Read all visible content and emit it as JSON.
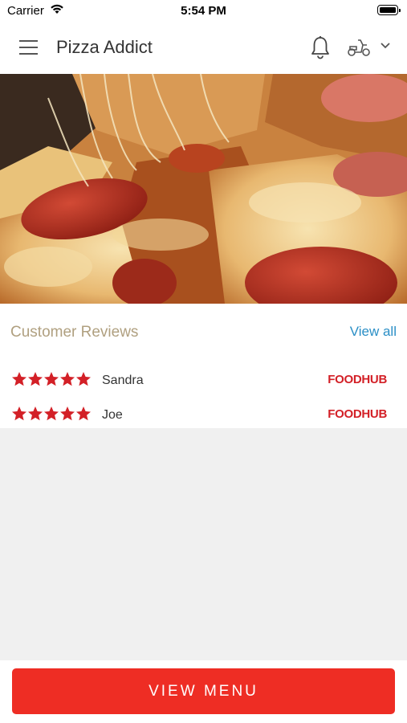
{
  "status_bar": {
    "carrier": "Carrier",
    "time": "5:54 PM"
  },
  "header": {
    "title": "Pizza Addict"
  },
  "icons": {
    "menu": "hamburger-menu-icon",
    "notifications": "bell-icon",
    "order_type": "scooter-delivery-icon",
    "dropdown": "chevron-down-icon"
  },
  "reviews": {
    "title": "Customer Reviews",
    "view_all": "View all",
    "items": [
      {
        "name": "Sandra",
        "rating": 5,
        "source": "FOODHUB"
      },
      {
        "name": "Joe",
        "rating": 5,
        "source": "FOODHUB"
      }
    ]
  },
  "footer": {
    "button_label": "VIEW MENU"
  },
  "colors": {
    "accent": "#ee2d24",
    "star": "#d32027",
    "link": "#2b8fc6",
    "section_title": "#b0a080",
    "background": "#f0f0f0"
  }
}
